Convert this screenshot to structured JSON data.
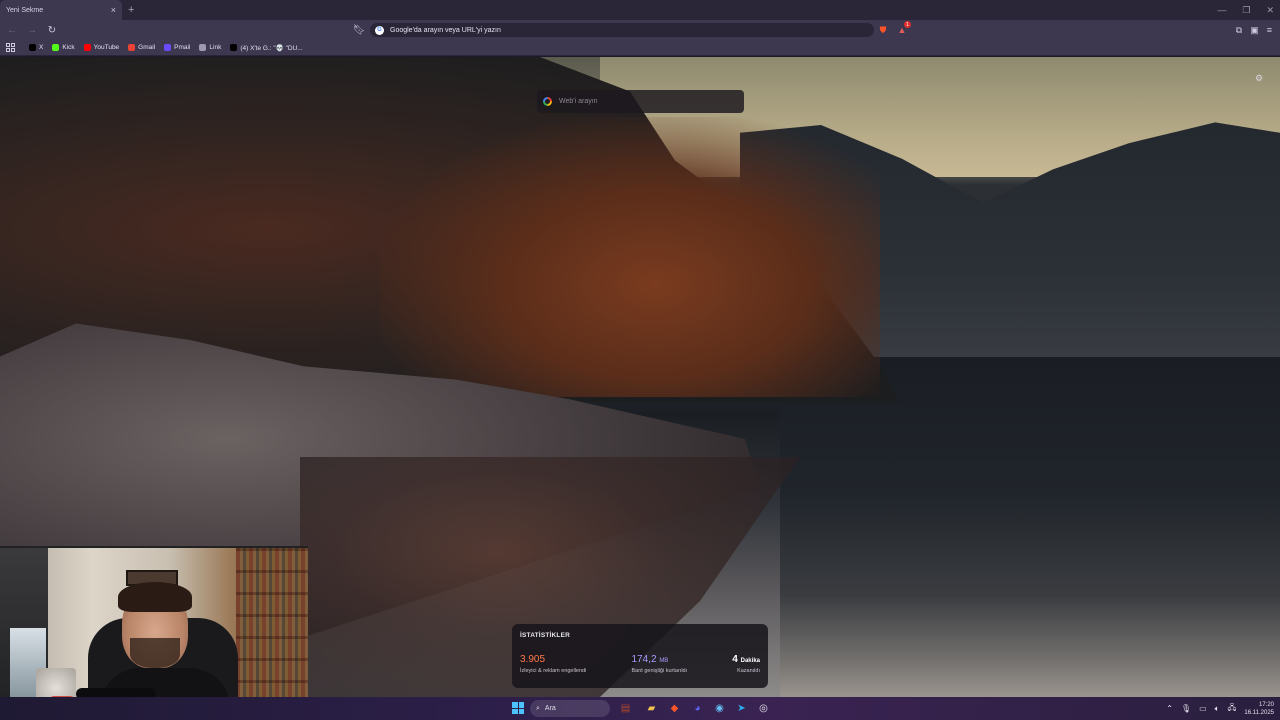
{
  "browser": {
    "tab": {
      "title": "Yeni Sekme"
    },
    "omnibox": {
      "placeholder": "Google'da arayın veya URL'yi yazın"
    },
    "rewards_badge": "1",
    "bookmarks": [
      {
        "label": "X",
        "icon": "x-icon",
        "color": "#000000"
      },
      {
        "label": "Kick",
        "icon": "kick-icon",
        "color": "#53fc18"
      },
      {
        "label": "YouTube",
        "icon": "youtube-icon",
        "color": "#ff0000"
      },
      {
        "label": "Gmail",
        "icon": "gmail-icon",
        "color": "#ea4335"
      },
      {
        "label": "Pmail",
        "icon": "pmail-icon",
        "color": "#6d4aff"
      },
      {
        "label": "Link",
        "icon": "link-icon",
        "color": "#9e98b0"
      },
      {
        "label": "(4) X'te G.: \"💀 \"DU...",
        "icon": "x-icon",
        "color": "#000000"
      }
    ]
  },
  "ntp": {
    "search_placeholder": "Web'i arayın",
    "stats": {
      "title": "İSTATİSTİKLER",
      "items": [
        {
          "value": "3.905",
          "unit": "",
          "label": "İzleyici & reklam engellendi",
          "color": "#ff7a4a"
        },
        {
          "value": "174,2",
          "unit": "MB",
          "label": "Bant genişliği kurtarıldı",
          "color": "#a79bff"
        },
        {
          "value": "4",
          "unit": "Dakika",
          "label": "Kazanıldı",
          "color": "#ffffff"
        }
      ]
    }
  },
  "taskbar": {
    "search_label": "Ara",
    "apps": [
      {
        "name": "winrar-icon",
        "glyph": "▤",
        "color": "#b04a2a"
      },
      {
        "name": "file-explorer-icon",
        "glyph": "▰",
        "color": "#f2c14e"
      },
      {
        "name": "brave-icon",
        "glyph": "◆",
        "color": "#fb542b"
      },
      {
        "name": "discord-icon",
        "glyph": "◕",
        "color": "#5865f2"
      },
      {
        "name": "steam-icon",
        "glyph": "◉",
        "color": "#66c0f4"
      },
      {
        "name": "telegram-icon",
        "glyph": "➤",
        "color": "#2aabee"
      },
      {
        "name": "chrome-icon",
        "glyph": "◎",
        "color": "#e8e6ee"
      }
    ],
    "time": "17:20",
    "date": "16.11.2025"
  }
}
